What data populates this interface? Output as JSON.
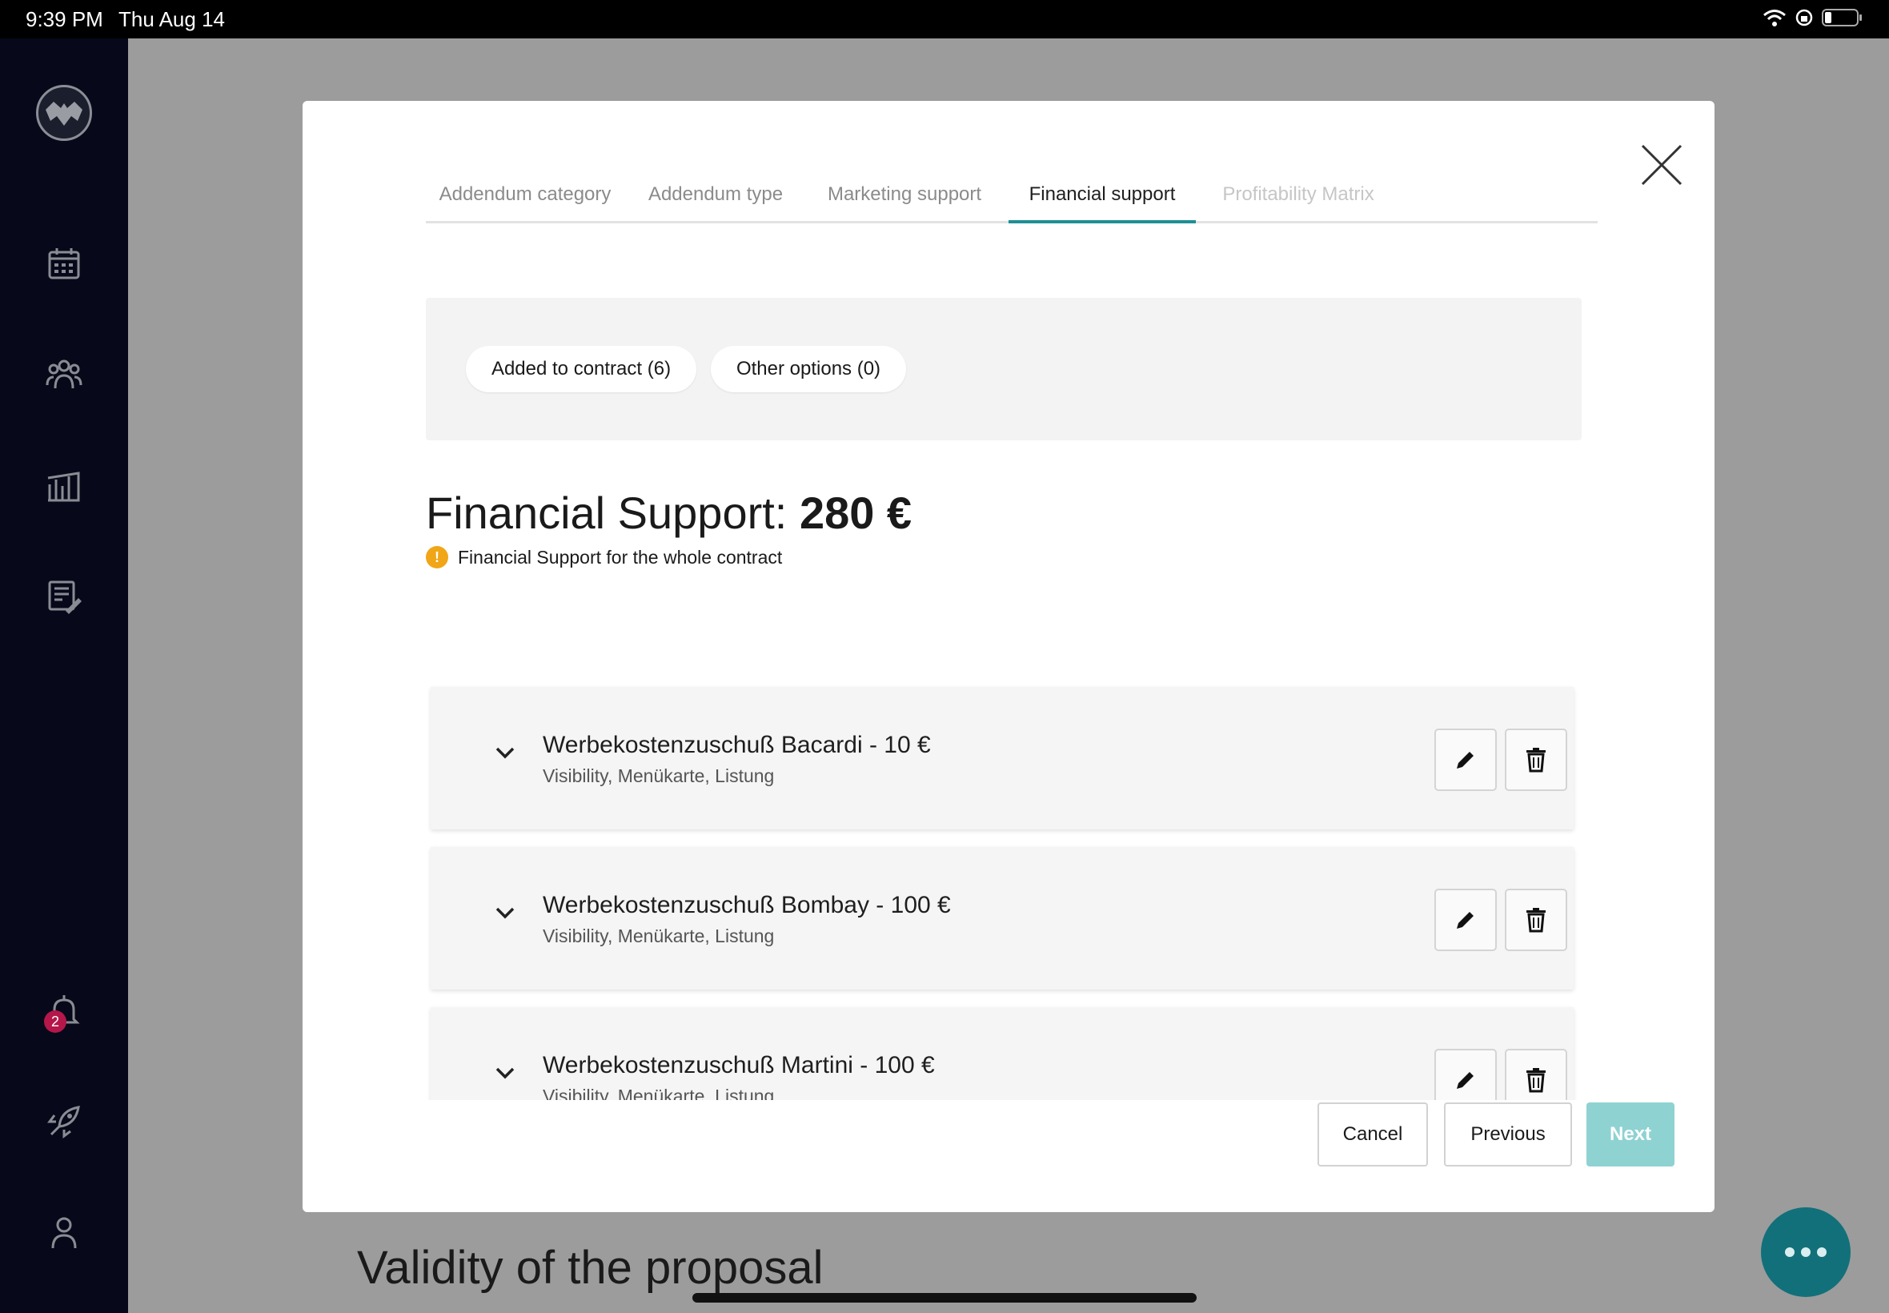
{
  "status_bar": {
    "time": "9:39 PM",
    "date": "Thu Aug 14"
  },
  "sidebar": {
    "logo": "bat-logo-icon",
    "items": [
      "calendar-icon",
      "people-icon",
      "chart-icon",
      "notes-edit-icon",
      "bell-icon",
      "rocket-icon",
      "user-icon"
    ],
    "notification_count": "2"
  },
  "background_page": {
    "heading": "Validity of the proposal"
  },
  "modal": {
    "tabs": [
      {
        "label": "Addendum category",
        "state": "normal"
      },
      {
        "label": "Addendum type",
        "state": "normal"
      },
      {
        "label": "Marketing support",
        "state": "normal"
      },
      {
        "label": "Financial support",
        "state": "active"
      },
      {
        "label": "Profitability Matrix",
        "state": "disabled"
      }
    ],
    "filters": {
      "added": "Added to contract (6)",
      "other": "Other options (0)"
    },
    "summary": {
      "label": "Financial Support:",
      "amount": "280 €",
      "note": "Financial Support for the whole contract",
      "note_icon": "!"
    },
    "items": [
      {
        "title": "Werbekostenzuschuß Bacardi -  10 €",
        "subtitle": "Visibility, Menükarte, Listung"
      },
      {
        "title": "Werbekostenzuschuß Bombay -  100 €",
        "subtitle": "Visibility, Menükarte, Listung"
      },
      {
        "title": "Werbekostenzuschuß Martini -  100 €",
        "subtitle": "Visibility, Menükarte, Listung"
      }
    ],
    "buttons": {
      "cancel": "Cancel",
      "previous": "Previous",
      "next": "Next"
    }
  },
  "colors": {
    "accent": "#1f8f95",
    "next_disabled": "#8fd2d2",
    "warning": "#f0a617",
    "badge": "#b5174a",
    "fab": "#12707a"
  }
}
